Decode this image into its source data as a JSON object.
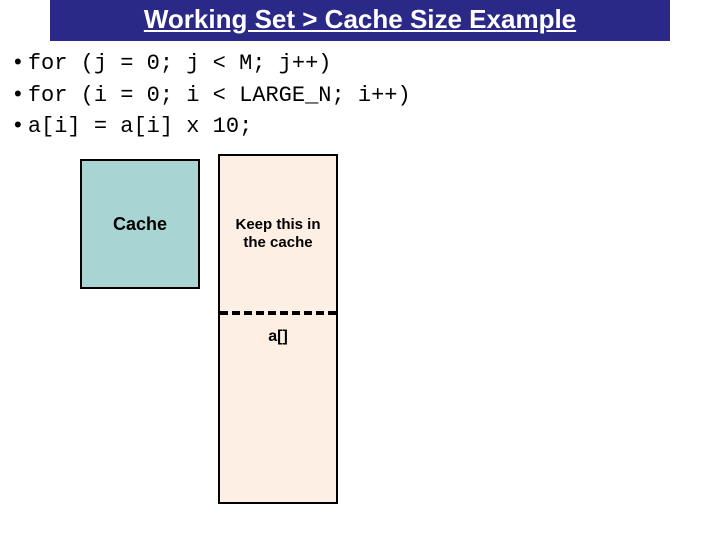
{
  "title": "Working Set > Cache Size Example",
  "code": {
    "line1": "for (j = 0; j < M; j++)",
    "line2": "   for (i = 0; i < LARGE_N; i++)",
    "line3": "      a[i] = a[i] x 10;"
  },
  "diagram": {
    "cache_label": "Cache",
    "array_top_text": "Keep this in the cache",
    "array_label": "a[]"
  }
}
